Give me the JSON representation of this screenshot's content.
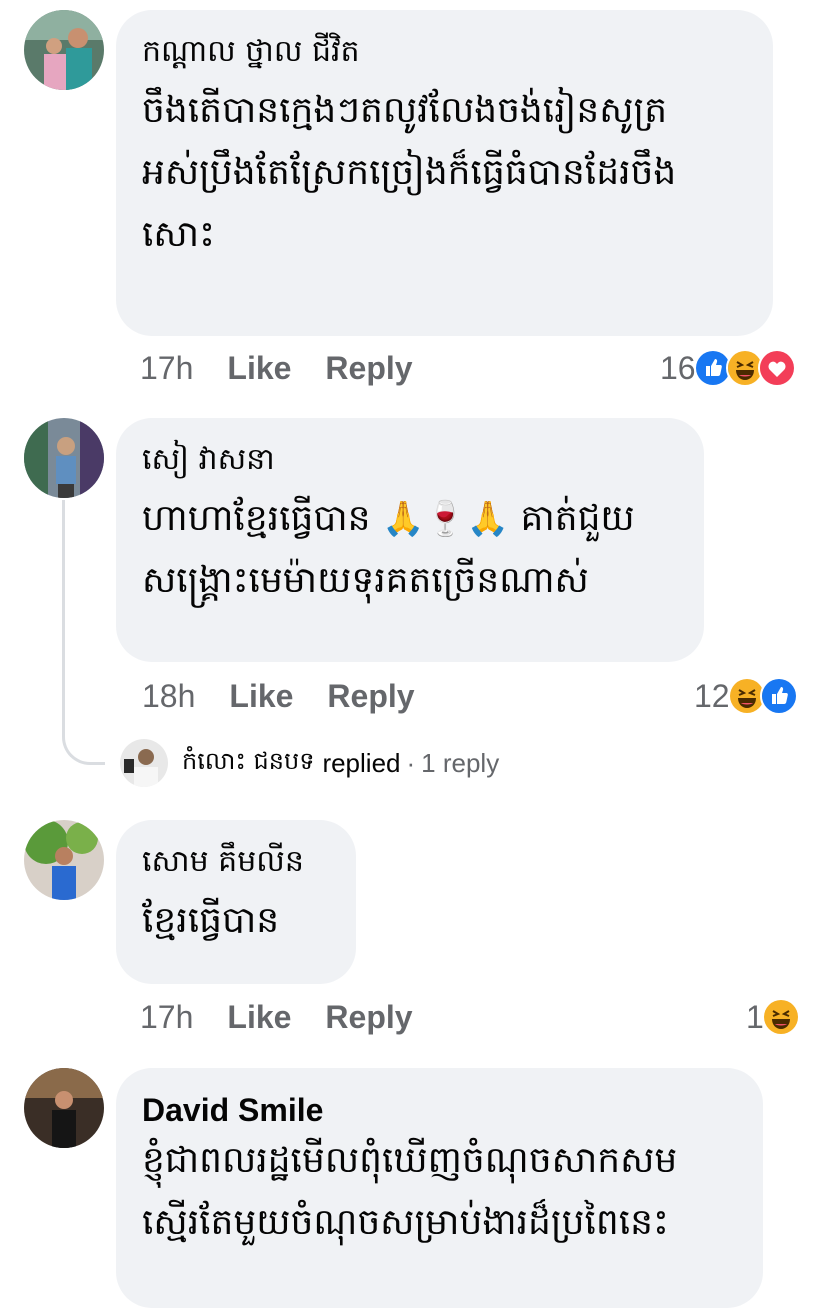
{
  "comments": [
    {
      "author": "កណ្តាល ថ្នាល ជីវិត",
      "lines": [
        "ចឹងតើបានក្មេងៗតលូវលែងចង់រៀនសូត្រ",
        "អស់ប្រឹងតែស្រែកច្រៀងក៏ធ្វើធំបានដែរចឹង",
        "សោះ"
      ],
      "time": "17h",
      "like_label": "Like",
      "reply_label": "Reply",
      "reaction_count": "16",
      "reactions": [
        "like-reaction-icon",
        "haha-reaction-icon",
        "love-reaction-icon"
      ]
    },
    {
      "author": "សៀ វាសនា",
      "lines": [
        "ហាហាខ្មែរធ្វើបាន",
        "គាត់ជួយ",
        "សង្គ្រោះមេម៉ាយទុរគតច្រើនណាស់"
      ],
      "emojis": [
        "🙏",
        "🍷",
        "🙏"
      ],
      "time": "18h",
      "like_label": "Like",
      "reply_label": "Reply",
      "reaction_count": "12",
      "reactions": [
        "haha-reaction-icon",
        "like-reaction-icon"
      ],
      "reply_preview": {
        "name": "កំលោះ ជនបទ",
        "replied_label": "replied",
        "separator": "·",
        "count_label": "1 reply"
      }
    },
    {
      "author": "សោម គឹមលីន",
      "lines": [
        "ខ្មែរធ្វើបាន"
      ],
      "time": "17h",
      "like_label": "Like",
      "reply_label": "Reply",
      "reaction_count": "1",
      "reactions": [
        "haha-reaction-icon"
      ]
    },
    {
      "author": "David Smile",
      "lines": [
        "ខ្ញុំជាពលរដ្ឋមើលពុំឃើញចំណុចសាកសម",
        "ស្មើរតែមួយចំណុចសម្រាប់ងារដ៏ប្រពៃនេះ"
      ]
    }
  ],
  "colors": {
    "bubble": "#f0f2f5",
    "meta": "#65676b",
    "like_blue": "#1877f2",
    "love_red": "#f33e58",
    "haha_yellow": "#f7b125"
  }
}
